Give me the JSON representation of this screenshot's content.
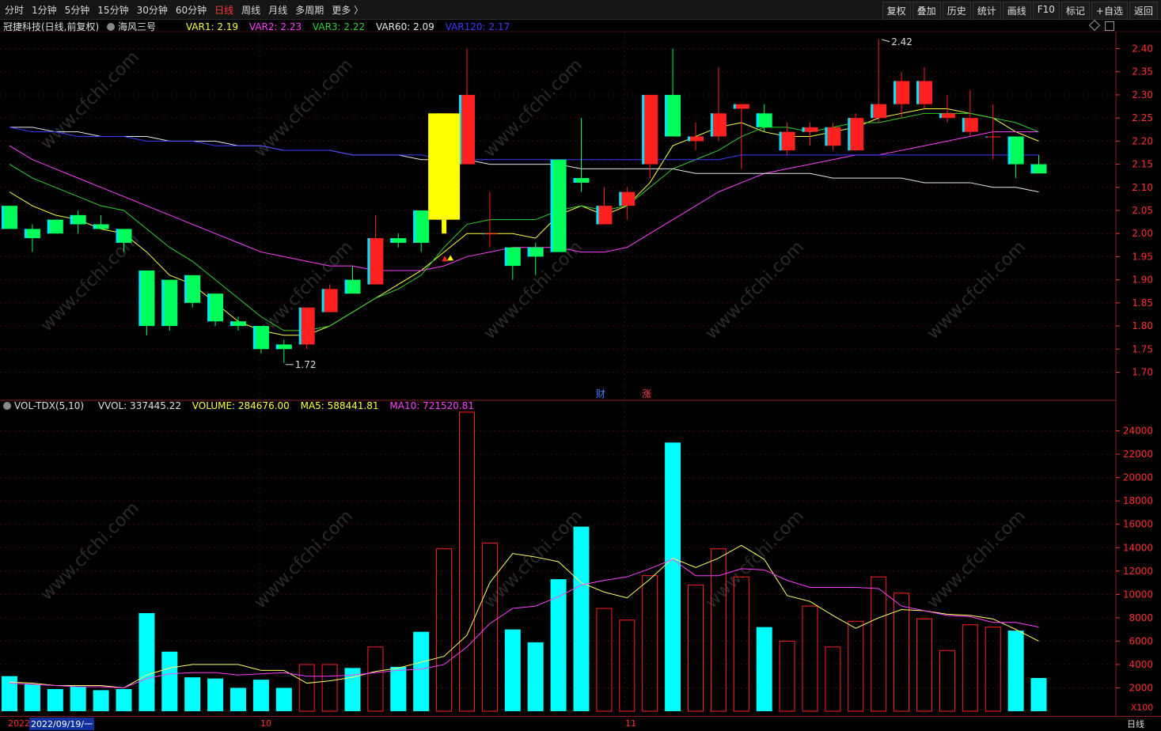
{
  "toolbar": {
    "periods": [
      "分时",
      "1分钟",
      "5分钟",
      "15分钟",
      "30分钟",
      "60分钟",
      "日线",
      "周线",
      "月线",
      "多周期",
      "更多 〉"
    ],
    "active": "日线",
    "actions": [
      "复权",
      "叠加",
      "历史",
      "统计",
      "画线",
      "F10",
      "标记",
      "+自选",
      "返回"
    ]
  },
  "main_legend": {
    "title": "冠捷科技(日线,前复权)",
    "indicator": "海风三号",
    "var1": "VAR1: 2.19",
    "var2": "VAR2: 2.23",
    "var3": "VAR3: 2.22",
    "var60": "VAR60: 2.09",
    "var120": "VAR120: 2.17"
  },
  "vol_legend": {
    "name": "VOL-TDX(5,10)",
    "vvol": "VVOL: 337445.22",
    "volume": "VOLUME: 284676.00",
    "ma5": "MA5: 588441.81",
    "ma10": "MA10: 721520.81"
  },
  "annotations": {
    "high": "2.42",
    "low": "1.72",
    "cai": "财",
    "zhang": "涨",
    "x100": "X100",
    "period_label": "日线"
  },
  "dates": {
    "start": "2022/09/19/一",
    "prefix": "2022",
    "oct": "10",
    "nov": "11"
  },
  "colors": {
    "up": "#ff2020",
    "down": "#00ff5a",
    "vol_down": "#00ffff",
    "var1": "#ffff40",
    "var2": "#ff40ff",
    "var3": "#30d030",
    "var60": "#e8e8e8",
    "var120": "#3a3aff",
    "ma5": "#ffff60",
    "ma10": "#ff40ff",
    "axis": "#ff3030"
  },
  "chart_data": [
    {
      "type": "candlestick",
      "title": "冠捷科技(日线,前复权)",
      "ylim": [
        1.67,
        2.43
      ],
      "y_ticks": [
        1.7,
        1.75,
        1.8,
        1.85,
        1.9,
        1.95,
        2.0,
        2.05,
        2.1,
        2.15,
        2.2,
        2.25,
        2.3,
        2.35,
        2.4
      ],
      "candles": [
        {
          "o": 2.06,
          "h": 2.06,
          "l": 2.01,
          "c": 2.01
        },
        {
          "o": 2.01,
          "h": 2.02,
          "l": 1.96,
          "c": 1.99
        },
        {
          "o": 2.03,
          "h": 2.03,
          "l": 2.0,
          "c": 2.0
        },
        {
          "o": 2.04,
          "h": 2.05,
          "l": 2.0,
          "c": 2.02
        },
        {
          "o": 2.02,
          "h": 2.04,
          "l": 2.01,
          "c": 2.01
        },
        {
          "o": 2.01,
          "h": 2.01,
          "l": 1.96,
          "c": 1.98
        },
        {
          "o": 1.92,
          "h": 1.92,
          "l": 1.78,
          "c": 1.8
        },
        {
          "o": 1.9,
          "h": 1.9,
          "l": 1.79,
          "c": 1.8
        },
        {
          "o": 1.91,
          "h": 1.91,
          "l": 1.84,
          "c": 1.85
        },
        {
          "o": 1.87,
          "h": 1.87,
          "l": 1.8,
          "c": 1.81
        },
        {
          "o": 1.81,
          "h": 1.82,
          "l": 1.79,
          "c": 1.8
        },
        {
          "o": 1.8,
          "h": 1.8,
          "l": 1.74,
          "c": 1.75
        },
        {
          "o": 1.76,
          "h": 1.77,
          "l": 1.72,
          "c": 1.75
        },
        {
          "o": 1.76,
          "h": 1.84,
          "l": 1.75,
          "c": 1.84
        },
        {
          "o": 1.83,
          "h": 1.89,
          "l": 1.83,
          "c": 1.88
        },
        {
          "o": 1.9,
          "h": 1.93,
          "l": 1.87,
          "c": 1.87
        },
        {
          "o": 1.89,
          "h": 2.04,
          "l": 1.89,
          "c": 1.99
        },
        {
          "o": 1.99,
          "h": 2.0,
          "l": 1.97,
          "c": 1.98
        },
        {
          "o": 2.05,
          "h": 2.05,
          "l": 1.96,
          "c": 1.98
        },
        {
          "o": 2.03,
          "h": 2.26,
          "l": 2.0,
          "c": 2.26
        },
        {
          "o": 2.15,
          "h": 2.4,
          "l": 2.15,
          "c": 2.3
        },
        {
          "o": 2.0,
          "h": 2.09,
          "l": 1.97,
          "c": 2.0
        },
        {
          "o": 1.97,
          "h": 1.97,
          "l": 1.9,
          "c": 1.93
        },
        {
          "o": 1.97,
          "h": 1.98,
          "l": 1.91,
          "c": 1.95
        },
        {
          "o": 2.16,
          "h": 2.16,
          "l": 1.96,
          "c": 1.96
        },
        {
          "o": 2.12,
          "h": 2.25,
          "l": 2.09,
          "c": 2.11
        },
        {
          "o": 2.02,
          "h": 2.1,
          "l": 2.02,
          "c": 2.06
        },
        {
          "o": 2.06,
          "h": 2.1,
          "l": 2.03,
          "c": 2.09
        },
        {
          "o": 2.15,
          "h": 2.3,
          "l": 2.12,
          "c": 2.3
        },
        {
          "o": 2.3,
          "h": 2.4,
          "l": 2.21,
          "c": 2.21
        },
        {
          "o": 2.2,
          "h": 2.24,
          "l": 2.18,
          "c": 2.21
        },
        {
          "o": 2.21,
          "h": 2.36,
          "l": 2.2,
          "c": 2.26
        },
        {
          "o": 2.27,
          "h": 2.28,
          "l": 2.14,
          "c": 2.28
        },
        {
          "o": 2.26,
          "h": 2.28,
          "l": 2.22,
          "c": 2.23
        },
        {
          "o": 2.18,
          "h": 2.24,
          "l": 2.17,
          "c": 2.22
        },
        {
          "o": 2.22,
          "h": 2.24,
          "l": 2.19,
          "c": 2.23
        },
        {
          "o": 2.19,
          "h": 2.24,
          "l": 2.18,
          "c": 2.23
        },
        {
          "o": 2.18,
          "h": 2.26,
          "l": 2.18,
          "c": 2.25
        },
        {
          "o": 2.25,
          "h": 2.42,
          "l": 2.24,
          "c": 2.28
        },
        {
          "o": 2.28,
          "h": 2.35,
          "l": 2.25,
          "c": 2.33
        },
        {
          "o": 2.28,
          "h": 2.36,
          "l": 2.27,
          "c": 2.33
        },
        {
          "o": 2.25,
          "h": 2.3,
          "l": 2.24,
          "c": 2.26
        },
        {
          "o": 2.22,
          "h": 2.31,
          "l": 2.21,
          "c": 2.25
        },
        {
          "o": 2.21,
          "h": 2.28,
          "l": 2.16,
          "c": 2.21
        },
        {
          "o": 2.21,
          "h": 2.21,
          "l": 2.12,
          "c": 2.15
        },
        {
          "o": 2.15,
          "h": 2.17,
          "l": 2.13,
          "c": 2.13
        }
      ],
      "lines": {
        "VAR1": [
          2.09,
          2.06,
          2.04,
          2.03,
          2.01,
          2.0,
          1.96,
          1.91,
          1.89,
          1.85,
          1.81,
          1.79,
          1.78,
          1.78,
          1.8,
          1.83,
          1.86,
          1.89,
          1.92,
          1.96,
          2.0,
          2.0,
          2.0,
          1.99,
          2.04,
          2.06,
          2.04,
          2.06,
          2.11,
          2.19,
          2.21,
          2.23,
          2.24,
          2.22,
          2.21,
          2.21,
          2.22,
          2.23,
          2.25,
          2.26,
          2.27,
          2.27,
          2.26,
          2.25,
          2.22,
          2.2
        ],
        "VAR2": [
          2.19,
          2.16,
          2.14,
          2.12,
          2.1,
          2.08,
          2.06,
          2.04,
          2.02,
          2.0,
          1.98,
          1.96,
          1.95,
          1.94,
          1.93,
          1.93,
          1.92,
          1.92,
          1.92,
          1.93,
          1.95,
          1.96,
          1.97,
          1.97,
          1.97,
          1.96,
          1.96,
          1.97,
          2.0,
          2.03,
          2.06,
          2.09,
          2.11,
          2.13,
          2.14,
          2.15,
          2.16,
          2.17,
          2.17,
          2.18,
          2.19,
          2.2,
          2.21,
          2.22,
          2.22,
          2.22
        ],
        "VAR3": [
          2.15,
          2.12,
          2.1,
          2.08,
          2.06,
          2.05,
          2.01,
          1.97,
          1.94,
          1.9,
          1.86,
          1.82,
          1.79,
          1.79,
          1.8,
          1.83,
          1.86,
          1.88,
          1.91,
          1.97,
          2.02,
          2.03,
          2.03,
          2.03,
          2.05,
          2.06,
          2.05,
          2.06,
          2.1,
          2.14,
          2.16,
          2.18,
          2.21,
          2.23,
          2.23,
          2.22,
          2.23,
          2.24,
          2.24,
          2.25,
          2.26,
          2.26,
          2.26,
          2.25,
          2.24,
          2.22
        ],
        "VAR60": [
          2.23,
          2.23,
          2.22,
          2.22,
          2.21,
          2.21,
          2.21,
          2.2,
          2.2,
          2.2,
          2.19,
          2.19,
          2.18,
          2.18,
          2.18,
          2.17,
          2.17,
          2.17,
          2.16,
          2.16,
          2.16,
          2.15,
          2.15,
          2.15,
          2.15,
          2.14,
          2.14,
          2.14,
          2.14,
          2.14,
          2.13,
          2.13,
          2.13,
          2.13,
          2.13,
          2.13,
          2.12,
          2.12,
          2.12,
          2.12,
          2.11,
          2.11,
          2.11,
          2.1,
          2.1,
          2.09
        ],
        "VAR120": [
          2.23,
          2.22,
          2.22,
          2.21,
          2.21,
          2.21,
          2.2,
          2.2,
          2.2,
          2.19,
          2.19,
          2.19,
          2.18,
          2.18,
          2.18,
          2.17,
          2.17,
          2.17,
          2.17,
          2.16,
          2.16,
          2.16,
          2.16,
          2.16,
          2.16,
          2.16,
          2.16,
          2.16,
          2.16,
          2.16,
          2.16,
          2.16,
          2.17,
          2.17,
          2.17,
          2.17,
          2.17,
          2.17,
          2.17,
          2.17,
          2.17,
          2.17,
          2.17,
          2.17,
          2.17,
          2.17
        ]
      },
      "high_label": "2.42",
      "low_label": "1.72"
    },
    {
      "type": "bar",
      "title": "VOL-TDX(5,10)",
      "unit": "X100",
      "ylim": [
        0,
        25800
      ],
      "y_ticks": [
        2000,
        4000,
        6000,
        8000,
        10000,
        12000,
        14000,
        16000,
        18000,
        20000,
        22000,
        24000
      ],
      "volumes": [
        3000,
        2300,
        1900,
        2100,
        1800,
        1900,
        8400,
        5100,
        2900,
        2800,
        2000,
        2700,
        2000,
        4000,
        4000,
        3700,
        5500,
        3800,
        6800,
        13900,
        25600,
        14400,
        7000,
        5900,
        11300,
        15800,
        8800,
        7800,
        11600,
        23000,
        10800,
        13900,
        11500,
        7200,
        6000,
        9000,
        5500,
        7700,
        11500,
        10100,
        7900,
        5200,
        7400,
        7200,
        6900,
        2846
      ],
      "MA5": [
        2500,
        2400,
        2200,
        2200,
        2200,
        2000,
        3100,
        3700,
        4000,
        4000,
        4000,
        3500,
        3500,
        2400,
        2600,
        2900,
        3400,
        3700,
        4200,
        4700,
        6500,
        11000,
        13500,
        13200,
        12800,
        11000,
        10200,
        9700,
        11300,
        13100,
        12300,
        13100,
        14200,
        13000,
        9900,
        9400,
        8200,
        7100,
        8000,
        8700,
        8600,
        8300,
        8200,
        7900,
        7000,
        6000
      ],
      "MA10": [
        2400,
        2300,
        2200,
        2100,
        2100,
        2000,
        2800,
        3200,
        3300,
        3300,
        3100,
        3200,
        3300,
        3000,
        3000,
        3100,
        3300,
        3500,
        3600,
        4000,
        5500,
        7500,
        8800,
        9000,
        9800,
        10800,
        11200,
        11500,
        12200,
        13000,
        11600,
        11600,
        12200,
        12100,
        11200,
        10600,
        10600,
        10600,
        10500,
        9000,
        8600,
        8200,
        8100,
        7600,
        7600,
        7200
      ]
    }
  ]
}
